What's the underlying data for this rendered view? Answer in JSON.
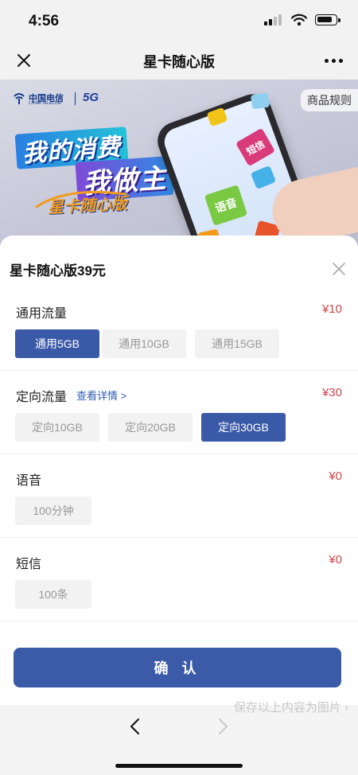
{
  "status_bar": {
    "time": "4:56"
  },
  "nav": {
    "title": "星卡随心版"
  },
  "banner": {
    "logo_text": "中国电信",
    "logo_subtext": "CHINA TELECOM",
    "logo_5g": "5G",
    "rules_label": "商品规则",
    "slogan_line1": "我的消费",
    "slogan_line2": "我做主",
    "product_script": "星卡随心版",
    "puzzle_labels": [
      "语音",
      "短信"
    ]
  },
  "sheet": {
    "title": "星卡随心版39元",
    "sections": [
      {
        "label": "通用流量",
        "price": "¥10",
        "options": [
          "通用5GB",
          "通用10GB",
          "通用15GB"
        ],
        "selected_index": 0
      },
      {
        "label": "定向流量",
        "link": "查看详情 >",
        "price": "¥30",
        "options": [
          "定向10GB",
          "定向20GB",
          "定向30GB"
        ],
        "selected_index": 2
      },
      {
        "label": "语音",
        "price": "¥0",
        "options": [
          "100分钟"
        ]
      },
      {
        "label": "短信",
        "price": "¥0",
        "options": [
          "100条"
        ]
      }
    ],
    "confirm_label": "确 认"
  },
  "footer": {
    "save_hint": "保存以上内容为图片 ›"
  },
  "colors": {
    "accent": "#3b5ba9",
    "price": "#d0464b",
    "link": "#2f5bb1"
  }
}
